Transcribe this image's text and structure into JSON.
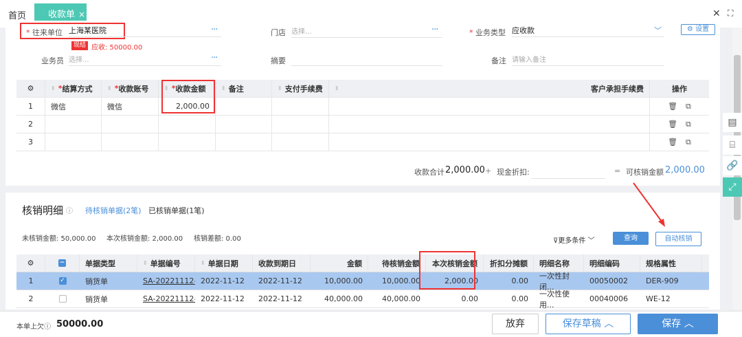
{
  "tabs": {
    "home": "首页",
    "active": "收款单",
    "close": "×"
  },
  "window": {
    "close": "✕",
    "fullscreen": "⛶"
  },
  "form": {
    "partner_label": "往来单位",
    "partner_value": "上海某医院",
    "cash_badge": "现结",
    "receivable": "应收: 50000.00",
    "store_label": "门店",
    "store_placeholder": "选择...",
    "biz_label": "业务类型",
    "biz_value": "应收款",
    "settings": "设置",
    "staff_label": "业务员",
    "staff_placeholder": "选择...",
    "summary_label": "摘要",
    "remark_label": "备注",
    "remark_placeholder": "请输入备注",
    "required": "*",
    "more": "···"
  },
  "pay_table": {
    "headers": [
      "结算方式",
      "收款账号",
      "收款金额",
      "备注",
      "支付手续费",
      "客户承担手续费",
      "操作"
    ],
    "rows": [
      {
        "idx": "1",
        "method": "微信",
        "account": "微信",
        "amount": "2,000.00"
      },
      {
        "idx": "2",
        "method": "",
        "account": "",
        "amount": ""
      },
      {
        "idx": "3",
        "method": "",
        "account": "",
        "amount": ""
      }
    ]
  },
  "totals": {
    "sum_label": "收款合计",
    "sum_value": "2,000.00",
    "plus": "+",
    "discount_label": "现金折扣:",
    "eq": "=",
    "writeoff_label": "可核销金额",
    "writeoff_value": "2,000.00"
  },
  "detail": {
    "title": "核销明细",
    "tab_pending": "待核销单据(2笔)",
    "tab_done": "已核销单据(1笔)",
    "unpaid": "未核销金额: 50,000.00",
    "this_amt": "本次核销金额: 2,000.00",
    "diff": "核销差额: 0.00",
    "more_filter": "更多条件",
    "query": "查询",
    "auto": "自动核销",
    "headers": [
      "单据类型",
      "单据编号",
      "单据日期",
      "收款到期日",
      "金额",
      "待核销金额",
      "本次核销金额",
      "折扣分摊额",
      "明细名称",
      "明细编码",
      "规格属性"
    ],
    "rows": [
      {
        "idx": "1",
        "type": "销货单",
        "no": "SA-20221112-(",
        "date": "2022-11-12",
        "due": "2022-11-12",
        "amount": "10,000.00",
        "pending": "10,000.00",
        "this": "2,000.00",
        "disc": "0.00",
        "name": "一次性封闭...",
        "code": "00050002",
        "spec": "DER-909"
      },
      {
        "idx": "2",
        "type": "销货单",
        "no": "SA-20221112-(",
        "date": "2022-11-12",
        "due": "2022-11-12",
        "amount": "40,000.00",
        "pending": "40,000.00",
        "this": "0.00",
        "disc": "0.00",
        "name": "一次性使用...",
        "code": "00040006",
        "spec": "WE-12"
      }
    ]
  },
  "footer": {
    "prev_label": "本单上欠",
    "prev_value": "50000.00",
    "discard": "放弃",
    "draft": "保存草稿",
    "save": "保存"
  },
  "colors": {
    "accent": "#4dc8b4",
    "primary": "#4a8fd8",
    "highlight_row": "#a8c8f0",
    "red": "#e33"
  }
}
